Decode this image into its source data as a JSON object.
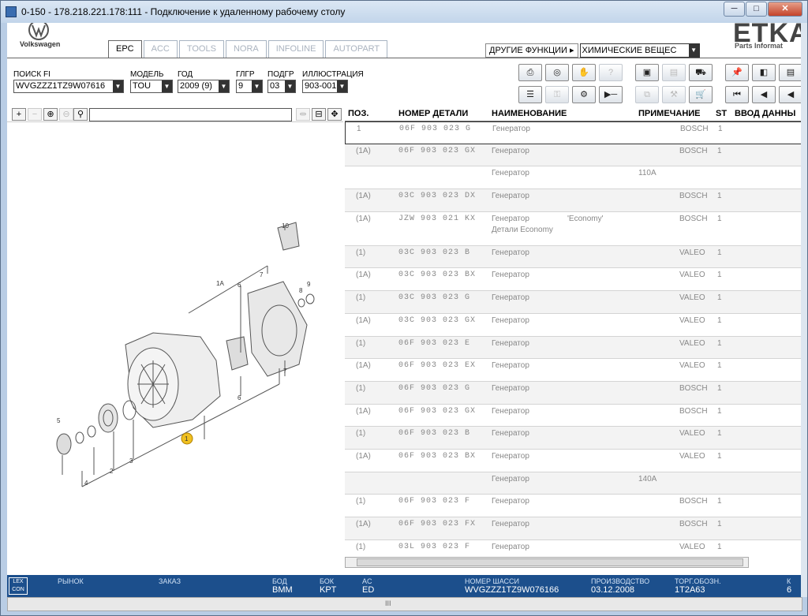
{
  "window": {
    "title": "0-150 - 178.218.221.178:111 - Подключение к удаленному рабочему столу"
  },
  "brand": {
    "vw_text": "Volkswagen",
    "etka": "ETKA",
    "etka_sub": "Parts Informat"
  },
  "tabs": [
    "EPC",
    "ACC",
    "TOOLS",
    "NORA",
    "INFOLINE",
    "AUTOPART"
  ],
  "other_functions": {
    "label": "ДРУГИЕ ФУНКЦИИ ▸",
    "value": "ХИМИЧЕСКИЕ ВЕЩЕС"
  },
  "filters": {
    "fi_label": "ПОИСК FI",
    "fi_value": "WVGZZZ1TZ9W07616",
    "model_label": "МОДЕЛЬ",
    "model_value": "TOU",
    "year_label": "ГОД",
    "year_value": "2009 (9)",
    "mgroup_label": "ГЛГР",
    "mgroup_value": "9",
    "sgroup_label": "ПОДГР",
    "sgroup_value": "03",
    "illus_label": "ИЛЛЮСТРАЦИЯ",
    "illus_value": "903-001"
  },
  "table": {
    "headers": {
      "pos": "ПОЗ.",
      "part": "НОМЕР ДЕТАЛИ",
      "name": "НАИМЕНОВАНИЕ",
      "note": "ПРИМЕЧАНИЕ",
      "st": "ST",
      "input": "ВВОД ДАННЫ"
    },
    "rows": [
      {
        "pos": "1",
        "part": "06F 903 023 G",
        "name": "Генератор",
        "note": "BOSCH",
        "st": "1"
      },
      {
        "pos": "(1A)",
        "part": "06F 903 023 GX",
        "name": "Генератор",
        "note": "BOSCH",
        "st": "1"
      },
      {
        "pos": "",
        "part": "",
        "name": "Генератор",
        "note": "110A",
        "st": ""
      },
      {
        "pos": "(1A)",
        "part": "03C 903 023 DX",
        "name": "Генератор",
        "note": "BOSCH",
        "st": "1"
      },
      {
        "pos": "(1A)",
        "part": "JZW 903 021 KX",
        "name": "Генератор",
        "name_extra": "'Economy'",
        "name2": "Детали Economy",
        "note": "BOSCH",
        "st": "1"
      },
      {
        "pos": "(1)",
        "part": "03C 903 023 B",
        "name": "Генератор",
        "note": "VALEO",
        "st": "1"
      },
      {
        "pos": "(1A)",
        "part": "03C 903 023 BX",
        "name": "Генератор",
        "note": "VALEO",
        "st": "1"
      },
      {
        "pos": "(1)",
        "part": "03C 903 023 G",
        "name": "Генератор",
        "note": "VALEO",
        "st": "1"
      },
      {
        "pos": "(1A)",
        "part": "03C 903 023 GX",
        "name": "Генератор",
        "note": "VALEO",
        "st": "1"
      },
      {
        "pos": "(1)",
        "part": "06F 903 023 E",
        "name": "Генератор",
        "note": "VALEO",
        "st": "1"
      },
      {
        "pos": "(1A)",
        "part": "06F 903 023 EX",
        "name": "Генератор",
        "note": "VALEO",
        "st": "1"
      },
      {
        "pos": "(1)",
        "part": "06F 903 023 G",
        "name": "Генератор",
        "note": "BOSCH",
        "st": "1"
      },
      {
        "pos": "(1A)",
        "part": "06F 903 023 GX",
        "name": "Генератор",
        "note": "BOSCH",
        "st": "1"
      },
      {
        "pos": "(1)",
        "part": "06F 903 023 B",
        "name": "Генератор",
        "note": "VALEO",
        "st": "1"
      },
      {
        "pos": "(1A)",
        "part": "06F 903 023 BX",
        "name": "Генератор",
        "note": "VALEO",
        "st": "1"
      },
      {
        "pos": "",
        "part": "",
        "name": "Генератор",
        "note": "140A",
        "st": ""
      },
      {
        "pos": "(1)",
        "part": "06F 903 023 F",
        "name": "Генератор",
        "note": "BOSCH",
        "st": "1"
      },
      {
        "pos": "(1A)",
        "part": "06F 903 023 FX",
        "name": "Генератор",
        "note": "BOSCH",
        "st": "1"
      },
      {
        "pos": "(1)",
        "part": "03L 903 023 F",
        "name": "Генератор",
        "note": "VALEO",
        "st": "1"
      }
    ]
  },
  "illustration": {
    "labels": [
      "10",
      "1A",
      "6",
      "7",
      "8",
      "9",
      "7",
      "6",
      "5",
      "4",
      "2",
      "3",
      "1"
    ]
  },
  "status": {
    "logo": "LEX CON",
    "market_label": "РЫНОК",
    "order_label": "ЗАКАЗ",
    "bod_label": "БОД",
    "bod_value": "BMM",
    "bok_label": "БОК",
    "bok_value": "KPT",
    "ac_label": "AC",
    "ac_value": "ED",
    "chassis_label": "НОМЕР ШАССИ",
    "chassis_value": "WVGZZZ1TZ9W076166",
    "prod_label": "ПРОИЗВОДСТВО",
    "prod_value": "03.12.2008",
    "trade_label": "ТОРГ.ОБОЗН.",
    "trade_value": "1T2A63",
    "extra_label": "К",
    "extra_value": "6"
  },
  "scroll": {
    "grip": "III"
  }
}
